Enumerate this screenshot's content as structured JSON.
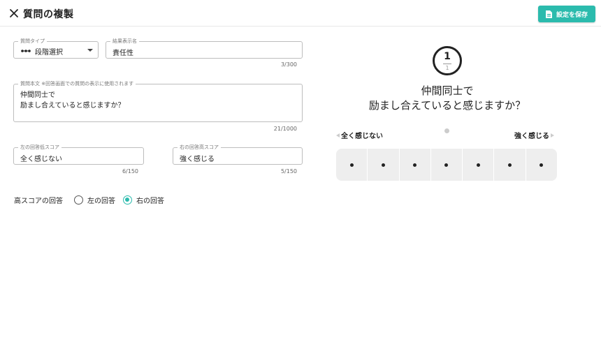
{
  "header": {
    "title": "質問の複製",
    "save_label": "設定を保存",
    "accent_color": "#2bbbad"
  },
  "form": {
    "question_type": {
      "label": "質問タイプ",
      "value": "段階選択",
      "icon": "dots-scale-icon"
    },
    "result_name": {
      "label": "結果表示名",
      "value": "責任性",
      "counter": "3/300"
    },
    "question_body": {
      "label": "質問本文 ※回答画面での質問の表示に使用されます",
      "value": "仲間同士で\n励まし合えていると感じますか？",
      "counter": "21/1000"
    },
    "left_score": {
      "label": "左の回答低スコア",
      "value": "全く感じない",
      "counter": "6/150"
    },
    "right_score": {
      "label": "右の回答高スコア",
      "value": "強く感じる",
      "counter": "5/150"
    },
    "high_score": {
      "label": "高スコアの回答",
      "options": [
        "左の回答",
        "右の回答"
      ],
      "selected": "右の回答"
    }
  },
  "preview": {
    "number": "1",
    "total": "1",
    "question": "仲間同士で\n励まし合えていると感じますか？",
    "left_label": "全く感じない",
    "right_label": "強く感じる",
    "scale_count": 7
  }
}
